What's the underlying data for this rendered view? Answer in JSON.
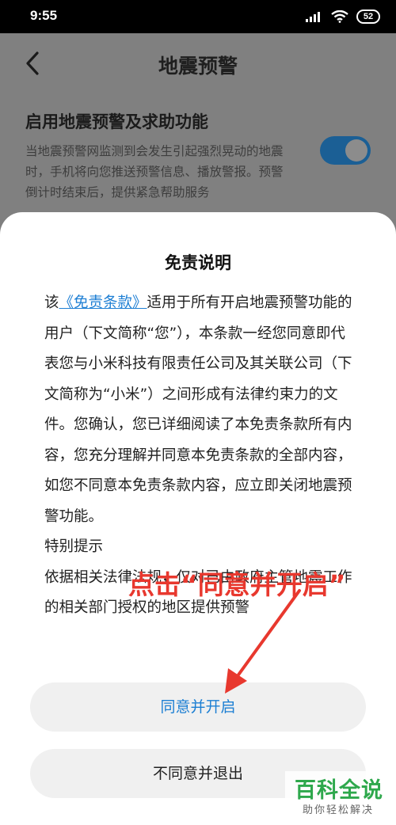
{
  "status_bar": {
    "time": "9:55",
    "battery": "52"
  },
  "header": {
    "title": "地震预警"
  },
  "setting": {
    "title": "启用地震预警及求助功能",
    "description": "当地震预警网监测到会发生引起强烈晃动的地震时，手机将向您推送预警信息、播放警报。预警倒计时结束后，提供紧急帮助服务",
    "enabled": true
  },
  "dialog": {
    "title": "免责说明",
    "paragraphs": [
      {
        "prefix": "该",
        "link": "《免责条款》",
        "text": "适用于所有开启地震预警功能的用户（下文简称“您”），本条款一经您同意即代表您与小米科技有限责任公司及其关联公司（下文简称为“小米”）之间形成有法律约束力的文件。您确认，您已详细阅读了本免责条款所有内容，您充分理解并同意本免责条款的全部内容，如您不同意本免责条款内容，应立即关闭地震预警功能。"
      }
    ],
    "note_heading": "特别提示",
    "note_text": "依据相关法律法规，仅对已由政府主管地震工作的相关部门授权的地区提供预警",
    "agree_button": "同意并开启",
    "decline_button": "不同意并退出"
  },
  "annotation": {
    "text": "点击“同意并开启”",
    "color": "#e8382e"
  },
  "watermark": {
    "main": "百科全说",
    "sub": "助你轻松解决"
  },
  "colors": {
    "accent": "#1e7fd4",
    "toggle_on": "#1b5f95"
  }
}
